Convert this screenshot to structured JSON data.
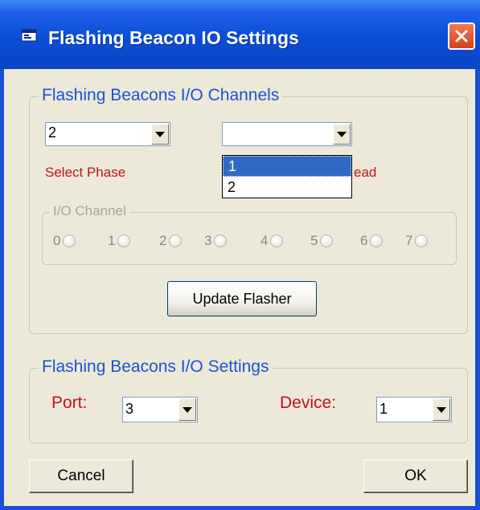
{
  "window": {
    "title": "Flashing Beacon IO Settings"
  },
  "channels_group": {
    "legend": "Flashing Beacons I/O Channels",
    "phase_combo_value": "2",
    "second_combo_value": "",
    "select_phase_label": "Select Phase",
    "obscured_label": "ead",
    "dropdown_options": [
      "1",
      "2"
    ],
    "io_channel_legend": "I/O Channel",
    "channels": [
      "0",
      "1",
      "2",
      "3",
      "4",
      "5",
      "6",
      "7"
    ],
    "update_button": "Update Flasher"
  },
  "settings_group": {
    "legend": "Flashing Beacons I/O Settings",
    "port_label": "Port:",
    "port_value": "3",
    "device_label": "Device:",
    "device_value": "1"
  },
  "buttons": {
    "cancel": "Cancel",
    "ok": "OK"
  },
  "colors": {
    "titlebar": "#0a4ed6",
    "dialog_bg": "#ece9d8",
    "legend_blue": "#1b52d8",
    "label_red": "#c0121a",
    "selection": "#316ac5"
  },
  "icons": {
    "app": "window-app-icon",
    "close": "close-x-icon"
  }
}
